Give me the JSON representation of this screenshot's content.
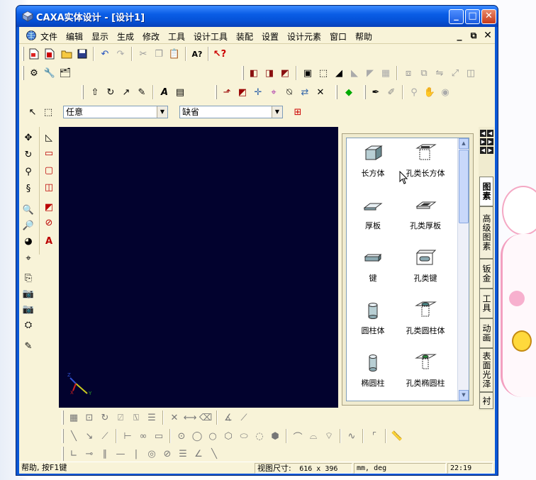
{
  "window": {
    "title": "CAXA实体设计 - [设计1]",
    "buttons": {
      "minimize": "_",
      "maximize": "□",
      "close": "✕"
    }
  },
  "menu": {
    "items": [
      "文件",
      "编辑",
      "显示",
      "生成",
      "修改",
      "工具",
      "设计工具",
      "装配",
      "设置",
      "设计元素",
      "窗口",
      "帮助"
    ]
  },
  "selection_bar": {
    "filter_value": "任意",
    "mode_value": "缺省"
  },
  "catalog": {
    "items": [
      {
        "label": "长方体",
        "icon": "box-icon"
      },
      {
        "label": "孔类长方体",
        "icon": "hole-box-icon"
      },
      {
        "label": "厚板",
        "icon": "thick-plate-icon"
      },
      {
        "label": "孔类厚板",
        "icon": "hole-plate-icon"
      },
      {
        "label": "键",
        "icon": "key-icon"
      },
      {
        "label": "孔类键",
        "icon": "hole-key-icon"
      },
      {
        "label": "圆柱体",
        "icon": "cylinder-icon"
      },
      {
        "label": "孔类圆柱体",
        "icon": "hole-cylinder-icon"
      },
      {
        "label": "椭圆柱",
        "icon": "elliptic-cylinder-icon"
      },
      {
        "label": "孔类椭圆柱",
        "icon": "hole-elliptic-cylinder-icon"
      }
    ],
    "tabs": [
      "图素",
      "高级图素",
      "钣金",
      "工具",
      "动画",
      "表面光泽",
      "衬"
    ]
  },
  "status": {
    "help": "帮助, 按F1键",
    "viewsize_label": "视图尺寸:",
    "viewsize_value": "616 x  396",
    "units": "mm, deg",
    "clock": "22:19"
  },
  "colors": {
    "viewport_bg": "#02022e",
    "client_bg": "#f8f3d8",
    "titlebar": "#0a5de6"
  }
}
